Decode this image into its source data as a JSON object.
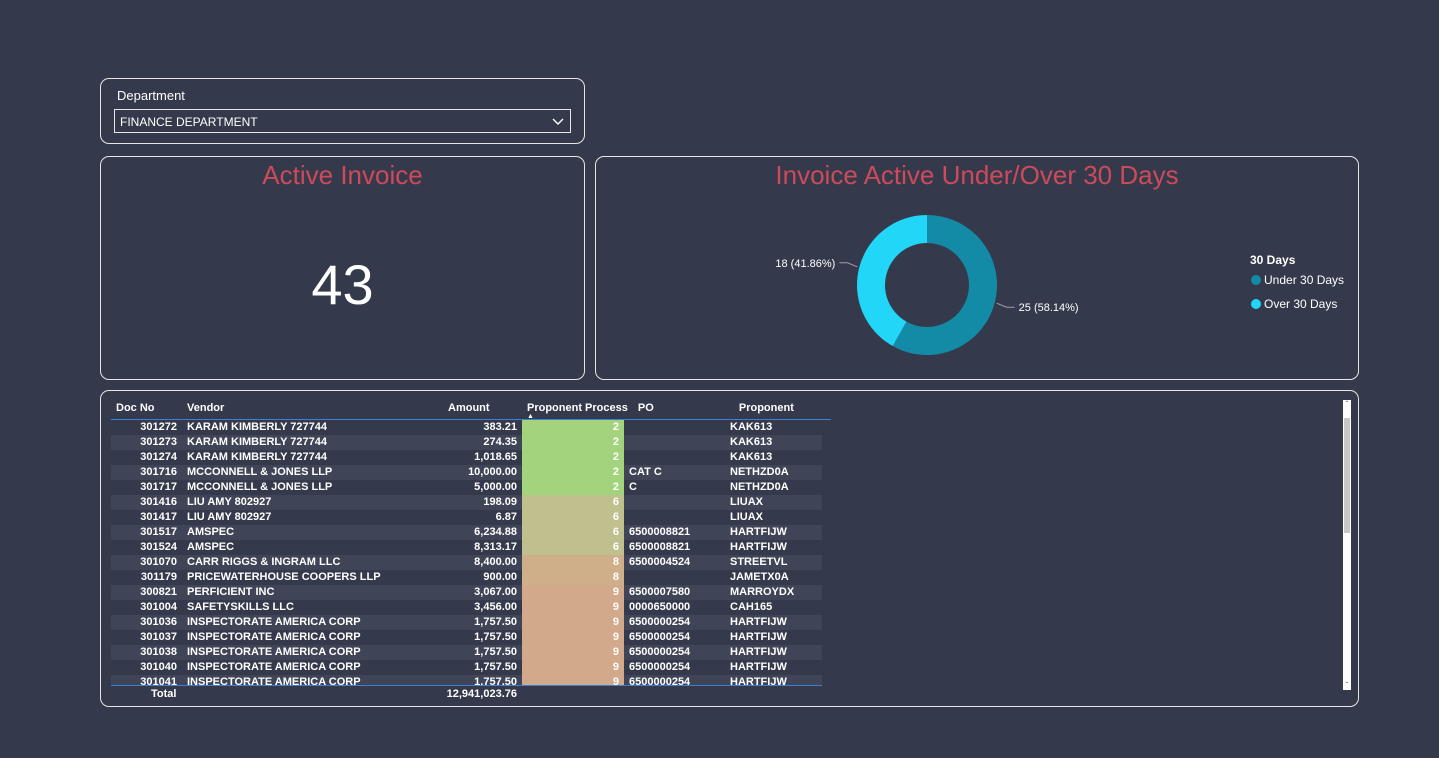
{
  "slicer": {
    "label": "Department",
    "selected": "FINANCE DEPARTMENT"
  },
  "kpi": {
    "title": "Active Invoice",
    "value": "43"
  },
  "donut": {
    "title": "Invoice Active Under/Over 30 Days",
    "legend_title": "30 Days",
    "colors": {
      "under": "#138ba7",
      "over": "#21d6f7"
    }
  },
  "chart_data": {
    "type": "pie",
    "subtype": "donut",
    "title": "Invoice Active Under/Over 30 Days",
    "legend_title": "30 Days",
    "legend_position": "right",
    "categories": [
      "Under 30 Days",
      "Over 30 Days"
    ],
    "values": [
      25,
      18
    ],
    "labels": [
      "25 (58.14%)",
      "18 (41.86%)"
    ],
    "colors": [
      "#138ba7",
      "#21d6f7"
    ]
  },
  "table": {
    "columns": [
      "Doc No",
      "Vendor",
      "Amount",
      "Proponent Process",
      "PO",
      "Proponent"
    ],
    "rows": [
      [
        "301272",
        "KARAM KIMBERLY 727744",
        "383.21",
        "2",
        "",
        "KAK613"
      ],
      [
        "301273",
        "KARAM KIMBERLY 727744",
        "274.35",
        "2",
        "",
        "KAK613"
      ],
      [
        "301274",
        "KARAM KIMBERLY 727744",
        "1,018.65",
        "2",
        "",
        "KAK613"
      ],
      [
        "301716",
        "MCCONNELL & JONES LLP",
        "10,000.00",
        "2",
        "CAT C",
        "NETHZD0A"
      ],
      [
        "301717",
        "MCCONNELL & JONES LLP",
        "5,000.00",
        "2",
        "C",
        "NETHZD0A"
      ],
      [
        "301416",
        "LIU AMY 802927",
        "198.09",
        "6",
        "",
        "LIUAX"
      ],
      [
        "301417",
        "LIU AMY 802927",
        "6.87",
        "6",
        "",
        "LIUAX"
      ],
      [
        "301517",
        "AMSPEC",
        "6,234.88",
        "6",
        "6500008821",
        "HARTFIJW"
      ],
      [
        "301524",
        "AMSPEC",
        "8,313.17",
        "6",
        "6500008821",
        "HARTFIJW"
      ],
      [
        "301070",
        "CARR RIGGS & INGRAM LLC",
        "8,400.00",
        "8",
        "6500004524",
        "STREETVL"
      ],
      [
        "301179",
        "PRICEWATERHOUSE COOPERS LLP",
        "900.00",
        "8",
        "",
        "JAMETX0A"
      ],
      [
        "300821",
        "PERFICIENT INC",
        "3,067.00",
        "9",
        "6500007580",
        "MARROYDX"
      ],
      [
        "301004",
        "SAFETYSKILLS LLC",
        "3,456.00",
        "9",
        "0000650000",
        "CAH165"
      ],
      [
        "301036",
        "INSPECTORATE AMERICA CORP",
        "1,757.50",
        "9",
        "6500000254",
        "HARTFIJW"
      ],
      [
        "301037",
        "INSPECTORATE AMERICA CORP",
        "1,757.50",
        "9",
        "6500000254",
        "HARTFIJW"
      ],
      [
        "301038",
        "INSPECTORATE AMERICA CORP",
        "1,757.50",
        "9",
        "6500000254",
        "HARTFIJW"
      ],
      [
        "301040",
        "INSPECTORATE AMERICA CORP",
        "1,757.50",
        "9",
        "6500000254",
        "HARTFIJW"
      ],
      [
        "301041",
        "INSPECTORATE AMERICA CORP",
        "1,757.50",
        "9",
        "6500000254",
        "HARTFIJW"
      ]
    ],
    "process_colors": {
      "2": "#a3d37c",
      "6": "#bfc08d",
      "8": "#cfae8a",
      "9": "#d2a98b"
    },
    "total": {
      "label": "Total",
      "amount": "12,941,023.76"
    }
  }
}
